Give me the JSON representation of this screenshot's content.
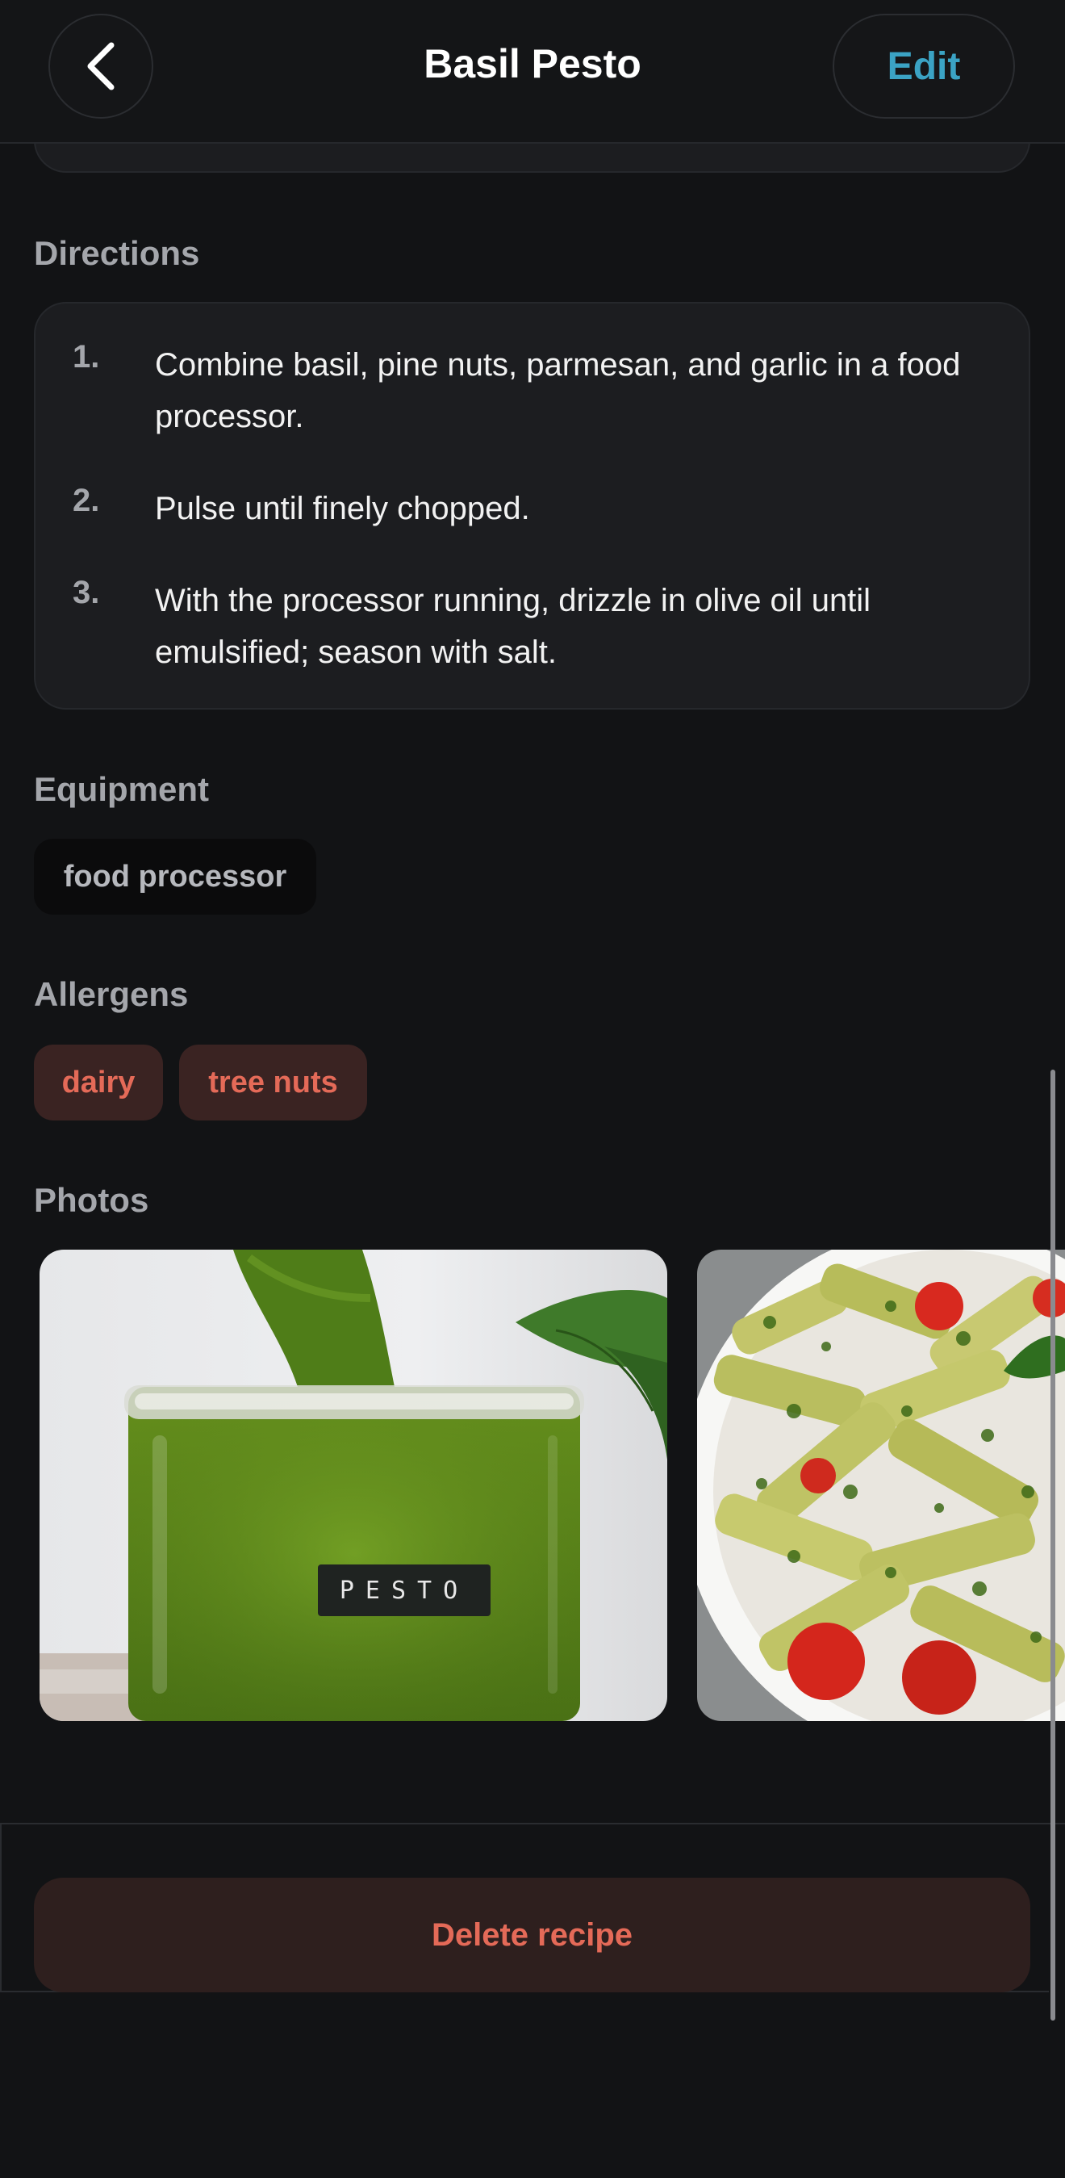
{
  "header": {
    "title": "Basil Pesto",
    "edit_label": "Edit",
    "back_icon": "chevron-left-icon"
  },
  "directions": {
    "label": "Directions",
    "steps": [
      {
        "num": "1.",
        "text": "Combine basil, pine nuts, parmesan, and garlic in a food processor."
      },
      {
        "num": "2.",
        "text": "Pulse until finely chopped."
      },
      {
        "num": "3.",
        "text": "With the processor running, drizzle in olive oil until emulsified; season with salt."
      }
    ]
  },
  "equipment": {
    "label": "Equipment",
    "items": [
      "food processor"
    ]
  },
  "allergens": {
    "label": "Allergens",
    "items": [
      "dairy",
      "tree nuts"
    ]
  },
  "photos": {
    "label": "Photos",
    "items": [
      {
        "name": "pesto-jar-photo",
        "jar_label": "PESTO"
      },
      {
        "name": "pesto-pasta-photo"
      }
    ]
  },
  "actions": {
    "delete_label": "Delete recipe"
  },
  "colors": {
    "accent": "#3ba3c4",
    "danger": "#e46a58",
    "background": "#121315"
  }
}
